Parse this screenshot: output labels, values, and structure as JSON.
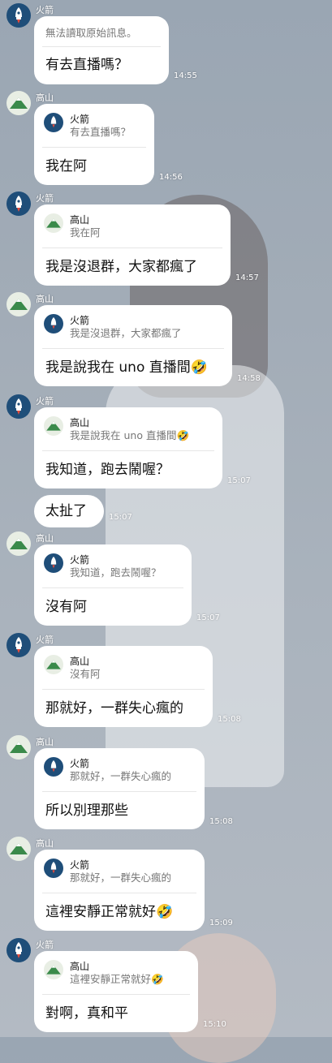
{
  "users": {
    "rocket": "火箭",
    "mountain": "高山"
  },
  "messages": [
    {
      "sender": "火箭",
      "quote_name": "",
      "quote_text": "無法讀取原始訊息。",
      "body": "有去直播嗎？",
      "time": "14:55"
    },
    {
      "sender": "高山",
      "quote_name": "火箭",
      "quote_text": "有去直播嗎？",
      "body": "我在阿",
      "time": "14:56"
    },
    {
      "sender": "火箭",
      "quote_name": "高山",
      "quote_text": "我在阿",
      "body": "我是沒退群，大家都瘋了",
      "time": "14:57"
    },
    {
      "sender": "高山",
      "quote_name": "火箭",
      "quote_text": "我是沒退群，大家都瘋了",
      "body": "我是說我在 uno 直播間🤣",
      "time": "14:58"
    },
    {
      "sender": "火箭",
      "quote_name": "高山",
      "quote_text": "我是說我在 uno 直播間🤣",
      "body": "我知道，跑去鬧喔？",
      "time": "15:07"
    },
    {
      "sender": "",
      "quote_name": "",
      "quote_text": "",
      "body": "太扯了",
      "time": "15:07"
    },
    {
      "sender": "高山",
      "quote_name": "火箭",
      "quote_text": "我知道，跑去鬧喔？",
      "body": "沒有阿",
      "time": "15:07"
    },
    {
      "sender": "火箭",
      "quote_name": "高山",
      "quote_text": "沒有阿",
      "body": "那就好，一群失心瘋的",
      "time": "15:08"
    },
    {
      "sender": "高山",
      "quote_name": "火箭",
      "quote_text": "那就好，一群失心瘋的",
      "body": "所以別理那些",
      "time": "15:08"
    },
    {
      "sender": "高山",
      "quote_name": "火箭",
      "quote_text": "那就好，一群失心瘋的",
      "body": "這裡安靜正常就好🤣",
      "time": "15:09"
    },
    {
      "sender": "火箭",
      "quote_name": "高山",
      "quote_text": "這裡安靜正常就好🤣",
      "body": "對啊，真和平",
      "time": "15:10"
    }
  ]
}
